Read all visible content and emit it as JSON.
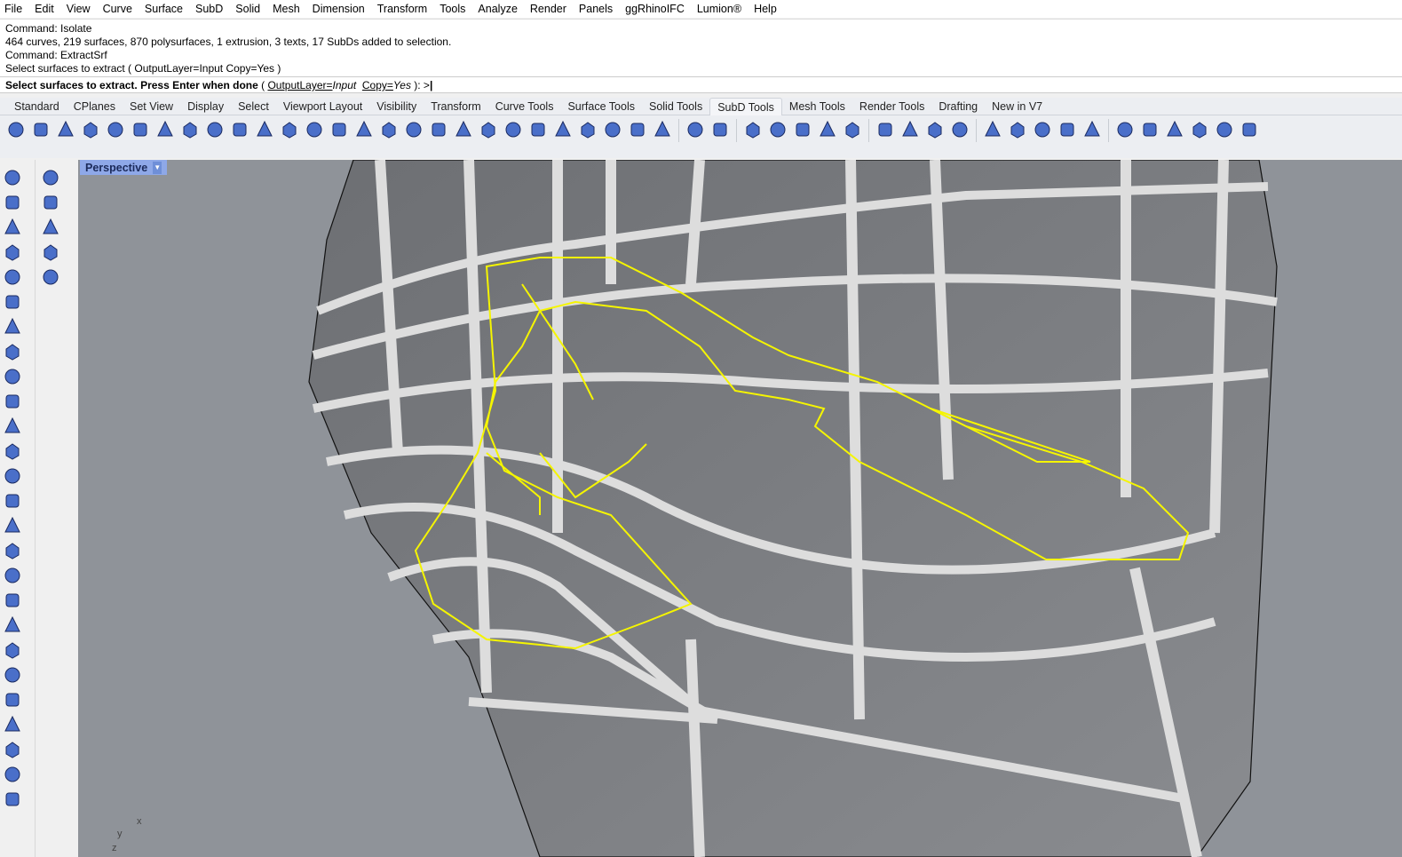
{
  "menu": [
    "File",
    "Edit",
    "View",
    "Curve",
    "Surface",
    "SubD",
    "Solid",
    "Mesh",
    "Dimension",
    "Transform",
    "Tools",
    "Analyze",
    "Render",
    "Panels",
    "ggRhinoIFC",
    "Lumion®",
    "Help"
  ],
  "command_history": [
    "Command: Isolate",
    "464 curves, 219 surfaces, 870 polysurfaces, 1 extrusion, 3 texts, 17 SubDs added to selection.",
    "Command: ExtractSrf",
    "Select surfaces to extract ( OutputLayer=Input  Copy=Yes )"
  ],
  "prompt": {
    "text": "Select surfaces to extract. Press Enter when done",
    "open": " ( ",
    "opt1_name": "OutputLayer=",
    "opt1_value": "Input",
    "opt2_name": "Copy=",
    "opt2_value": "Yes",
    "close": " ): >"
  },
  "tabs": [
    {
      "label": "Standard"
    },
    {
      "label": "CPlanes"
    },
    {
      "label": "Set View"
    },
    {
      "label": "Display"
    },
    {
      "label": "Select"
    },
    {
      "label": "Viewport Layout"
    },
    {
      "label": "Visibility"
    },
    {
      "label": "Transform"
    },
    {
      "label": "Curve Tools"
    },
    {
      "label": "Surface Tools"
    },
    {
      "label": "Solid Tools"
    },
    {
      "label": "SubD Tools",
      "active": true
    },
    {
      "label": "Mesh Tools"
    },
    {
      "label": "Render Tools"
    },
    {
      "label": "Drafting"
    },
    {
      "label": "New in V7"
    }
  ],
  "toolbar_icons": [
    "subd-box-icon",
    "subd-plane-icon",
    "subd-cone-icon",
    "subd-truncated-cone-icon",
    "subd-cylinder-icon",
    "subd-sphere-icon",
    "subd-quadsphere-icon",
    "subd-torus-icon",
    "subd-ellipsoid-icon",
    "subd-loft-1-icon",
    "subd-loft-2-icon",
    "subd-sweep-icon",
    "subd-branch-icon",
    "subd-fillet-icon",
    "subd-crease-icon",
    "subd-control-points-icon",
    "subd-bridge-icon",
    "subd-extrude-icon",
    "subd-insert-edge-icon",
    "subd-stitch-icon",
    "subd-append-icon",
    "subd-mirror-icon",
    "subd-slide-icon",
    "subd-grid-icon",
    "subd-subdivide-icon",
    "subd-cap-icon",
    "subd-cup-icon",
    "sep",
    "subd-weld-icon",
    "subd-unweld-icon",
    "sep",
    "subd-to-nurbs-icon",
    "subd-capsule-icon",
    "subd-patch-icon",
    "subd-reflect-icon",
    "subd-thicken-icon",
    "sep",
    "subd-repair-icon",
    "subd-list-icon",
    "subd-tools-icon",
    "subd-convert-icon",
    "sep",
    "subd-display-box-icon",
    "subd-edge-flow-icon",
    "subd-sphere-grid-icon",
    "subd-strip-icon",
    "subd-paint-icon",
    "sep",
    "select-subd-vertex-icon",
    "select-subd-face-icon",
    "select-subd-edge-icon",
    "deselect-subd-icon",
    "subd-filter-icon",
    "subd-favorite-icon"
  ],
  "left_toolbar": [
    "select-arrow-icon",
    "plane-icon",
    "layers-icon",
    "point-icon",
    "curve-offset-icon",
    "extrude-icon",
    "gear-explode-icon",
    "cylinder-icon",
    "cylinder-2-icon",
    "arc-icon",
    "fillet-icon",
    "surface-icon",
    "solid-icon",
    "line-icon",
    "dimension-icon",
    "text-icon",
    "mirror-icon",
    "skew-icon",
    "mesh-icon",
    "array-icon",
    "grid-array-icon",
    "circle-array-icon",
    "step-icon",
    "stack-icon",
    "lock-icon",
    "unlock-icon"
  ],
  "left_toolbar2": [
    "render-icon",
    "rotate-view-icon",
    "axis-icon",
    "trash-icon",
    "help-icon"
  ],
  "viewport": {
    "label": "Perspective",
    "axis_x": "x",
    "axis_y": "y",
    "axis_z": "z"
  },
  "colors": {
    "selection": "#f5f500",
    "viewport_bg": "#8f9399",
    "label_bg": "#8ea8e8",
    "icon_blue": "#4a6fc9"
  }
}
